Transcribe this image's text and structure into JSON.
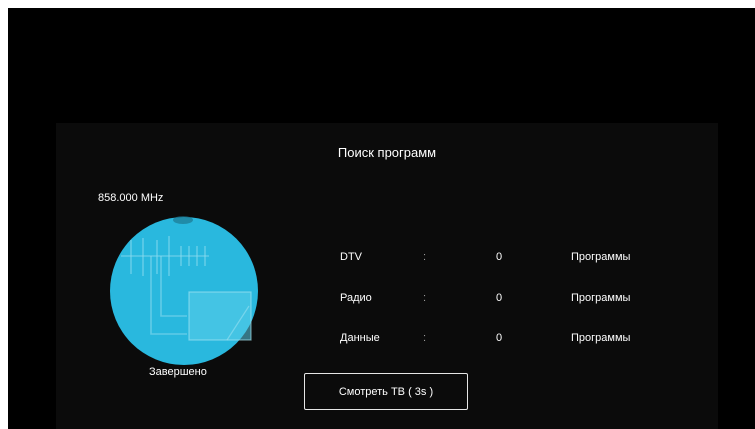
{
  "dialog": {
    "title": "Поиск программ",
    "frequency": "858.000 MHz",
    "status": "Завершено",
    "progress": 1.0,
    "accent_color": "#29b8de"
  },
  "results": [
    {
      "label": "DTV",
      "separator": ":",
      "count": "0",
      "unit": "Программы"
    },
    {
      "label": "Радио",
      "separator": ":",
      "count": "0",
      "unit": "Программы"
    },
    {
      "label": "Данные",
      "separator": ":",
      "count": "0",
      "unit": "Программы"
    }
  ],
  "watch_button": {
    "label": "Смотреть ТВ ( 3s )"
  },
  "icons": {
    "dial": "antenna-scan-icon"
  }
}
